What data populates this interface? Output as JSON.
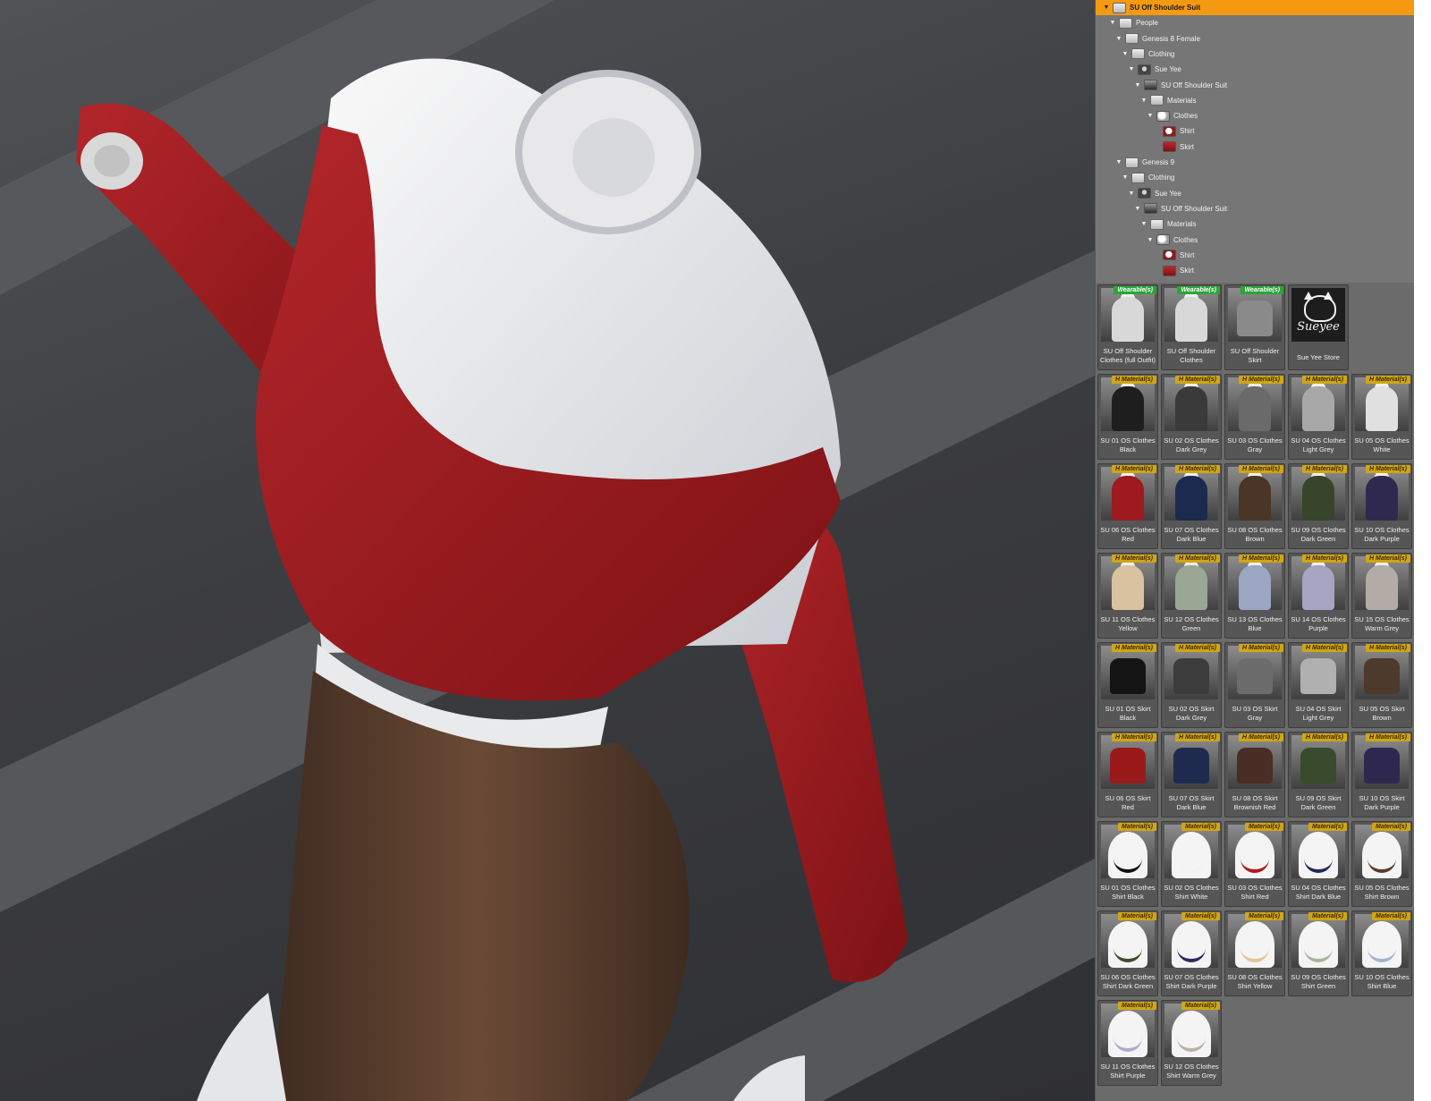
{
  "viewport": {
    "description_icon": "render-viewport"
  },
  "tree": {
    "rows": [
      {
        "label": "SU Off Shoulder Suit",
        "depth": 0,
        "icon": "folder",
        "selected": true
      },
      {
        "label": "People",
        "depth": 1,
        "icon": "folder"
      },
      {
        "label": "Genesis 8 Female",
        "depth": 2,
        "icon": "folder"
      },
      {
        "label": "Clothing",
        "depth": 3,
        "icon": "folder"
      },
      {
        "label": "Sue Yee",
        "depth": 4,
        "icon": "char"
      },
      {
        "label": "SU Off Shoulder Suit",
        "depth": 5,
        "icon": "fig"
      },
      {
        "label": "Materials",
        "depth": 6,
        "icon": "folder"
      },
      {
        "label": "Clothes",
        "depth": 7,
        "icon": "mat"
      },
      {
        "label": "Shirt",
        "depth": 8,
        "icon": "shirt"
      },
      {
        "label": "Skirt",
        "depth": 8,
        "icon": "skirt"
      },
      {
        "label": "Genesis 9",
        "depth": 2,
        "icon": "folder"
      },
      {
        "label": "Clothing",
        "depth": 3,
        "icon": "folder"
      },
      {
        "label": "Sue Yee",
        "depth": 4,
        "icon": "char"
      },
      {
        "label": "SU Off Shoulder Suit",
        "depth": 5,
        "icon": "fig"
      },
      {
        "label": "Materials",
        "depth": 6,
        "icon": "folder"
      },
      {
        "label": "Clothes",
        "depth": 7,
        "icon": "mat"
      },
      {
        "label": "Shirt",
        "depth": 8,
        "icon": "shirt"
      },
      {
        "label": "Skirt",
        "depth": 8,
        "icon": "skirt"
      }
    ]
  },
  "badges": {
    "wearable": "Wearable(s)",
    "material": "H Material(s)",
    "material_plain": "Material(s)"
  },
  "tiles": [
    {
      "label": "SU Off Shoulder Clothes (full Outfit)",
      "badge": "wearable",
      "kind": "outfit",
      "color": "#d8d8d8"
    },
    {
      "label": "SU Off Shoulder Clothes",
      "badge": "wearable",
      "kind": "shirt",
      "color": "#d8d8d8"
    },
    {
      "label": "SU Off Shoulder Skirt",
      "badge": "wearable",
      "kind": "skirt",
      "color": "#8a8a8a"
    },
    {
      "label": "Sue Yee Store",
      "badge": "none",
      "kind": "store",
      "brand": "Sueyee"
    },
    {
      "label": "SU 01 OS Clothes Black",
      "badge": "material",
      "kind": "shirt",
      "color": "#1e1e1e"
    },
    {
      "label": "SU 02 OS Clothes Dark Grey",
      "badge": "material",
      "kind": "shirt",
      "color": "#3a3a3a"
    },
    {
      "label": "SU 03 OS Clothes Gray",
      "badge": "material",
      "kind": "shirt",
      "color": "#6a6a6a"
    },
    {
      "label": "SU 04 OS Clothes Light Grey",
      "badge": "material",
      "kind": "shirt",
      "color": "#a8a8a8"
    },
    {
      "label": "SU 05 OS Clothes White",
      "badge": "material",
      "kind": "shirt",
      "color": "#e0e0e0"
    },
    {
      "label": "SU 06 OS Clothes Red",
      "badge": "material",
      "kind": "shirt",
      "color": "#9e1a1e"
    },
    {
      "label": "SU 07 OS Clothes Dark Blue",
      "badge": "material",
      "kind": "shirt",
      "color": "#1c2a4f"
    },
    {
      "label": "SU 08 OS Clothes Brown",
      "badge": "material",
      "kind": "shirt",
      "color": "#4a3526"
    },
    {
      "label": "SU 09 OS Clothes Dark Green",
      "badge": "material",
      "kind": "shirt",
      "color": "#37452a"
    },
    {
      "label": "SU 10 OS Clothes Dark Purple",
      "badge": "material",
      "kind": "shirt",
      "color": "#2f2950"
    },
    {
      "label": "SU 11 OS Clothes Yellow",
      "badge": "material",
      "kind": "shirt",
      "color": "#d9c2a0"
    },
    {
      "label": "SU 12 OS Clothes Green",
      "badge": "material",
      "kind": "shirt",
      "color": "#9aa794"
    },
    {
      "label": "SU 13 OS Clothes Blue",
      "badge": "material",
      "kind": "shirt",
      "color": "#9aa6c2"
    },
    {
      "label": "SU 14 OS Clothes Purple",
      "badge": "material",
      "kind": "shirt",
      "color": "#a7a4c4"
    },
    {
      "label": "SU 15 OS Clothes Warm Grey",
      "badge": "material",
      "kind": "shirt",
      "color": "#b3aca6"
    },
    {
      "label": "SU 01 OS Skirt Black",
      "badge": "material",
      "kind": "skirt",
      "color": "#141414"
    },
    {
      "label": "SU 02 OS Skirt Dark Grey",
      "badge": "material",
      "kind": "skirt",
      "color": "#3c3c3c"
    },
    {
      "label": "SU 03 OS Skirt Gray",
      "badge": "material",
      "kind": "skirt",
      "color": "#6c6c6c"
    },
    {
      "label": "SU 04 OS Skirt Light Grey",
      "badge": "material",
      "kind": "skirt",
      "color": "#b0b0b0"
    },
    {
      "label": "SU 05 OS Skirt Brown",
      "badge": "material",
      "kind": "skirt",
      "color": "#4e3a2c"
    },
    {
      "label": "SU 06 OS Skirt Red",
      "badge": "material",
      "kind": "skirt",
      "color": "#9a1a1c"
    },
    {
      "label": "SU 07 OS Skirt Dark Blue",
      "badge": "material",
      "kind": "skirt",
      "color": "#1e2b4e"
    },
    {
      "label": "SU 08 OS Skirt Brownish Red",
      "badge": "material",
      "kind": "skirt",
      "color": "#4a2d24"
    },
    {
      "label": "SU 09 OS Skirt Dark Green",
      "badge": "material",
      "kind": "skirt",
      "color": "#3a4a2c"
    },
    {
      "label": "SU 10 OS Skirt Dark Purple",
      "badge": "material",
      "kind": "skirt",
      "color": "#2e2850"
    },
    {
      "label": "SU 01 OS Clothes Shirt Black",
      "badge": "material_plain",
      "kind": "tank",
      "color": "#111111"
    },
    {
      "label": "SU 02 OS Clothes Shirt White",
      "badge": "material_plain",
      "kind": "tank",
      "color": "#f2f2f2"
    },
    {
      "label": "SU 03 OS Clothes Shirt Red",
      "badge": "material_plain",
      "kind": "tank",
      "color": "#b3161b"
    },
    {
      "label": "SU 04 OS Clothes Shirt Dark Blue",
      "badge": "material_plain",
      "kind": "tank",
      "color": "#1d2a55"
    },
    {
      "label": "SU 05 OS Clothes Shirt Brown",
      "badge": "material_plain",
      "kind": "tank",
      "color": "#5a3b2a"
    },
    {
      "label": "SU 06 OS Clothes Shirt Dark Green",
      "badge": "material_plain",
      "kind": "tank",
      "color": "#3c4b2a"
    },
    {
      "label": "SU 07 OS Clothes Shirt Dark Purple",
      "badge": "material_plain",
      "kind": "tank",
      "color": "#33295a"
    },
    {
      "label": "SU 08 OS Clothes Shirt Yellow",
      "badge": "material_plain",
      "kind": "tank",
      "color": "#e2c79c"
    },
    {
      "label": "SU 09 OS Clothes Shirt Green",
      "badge": "material_plain",
      "kind": "tank",
      "color": "#a6b49e"
    },
    {
      "label": "SU 10 OS Clothes Shirt Blue",
      "badge": "material_plain",
      "kind": "tank",
      "color": "#a6b2d2"
    },
    {
      "label": "SU 11 OS Clothes Shirt Purple",
      "badge": "material_plain",
      "kind": "tank",
      "color": "#aeabd0"
    },
    {
      "label": "SU 12 OS Clothes Shirt Warm Grey",
      "badge": "material_plain",
      "kind": "tank",
      "color": "#b9b2aa"
    }
  ]
}
